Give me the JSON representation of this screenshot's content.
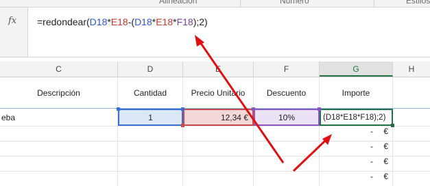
{
  "ribbon": {
    "groups": [
      "Alineación",
      "Número",
      "Estilos"
    ]
  },
  "formula_bar": {
    "fx_label": "fx",
    "parts": [
      "=redondear(",
      "D18",
      "*",
      "E18",
      "-(",
      "D18",
      "*",
      "E18",
      "*",
      "F18",
      ");2)"
    ]
  },
  "columns": [
    "C",
    "D",
    "E",
    "F",
    "G",
    "H"
  ],
  "active_column": "G",
  "header_row": {
    "c": "Descripción",
    "d": "Cantidad",
    "e": "Precio Unitario",
    "f": "Descuento",
    "g": "Importe"
  },
  "data_row": {
    "c": "eba",
    "d": "1",
    "e": "12,34 €",
    "f": "10%",
    "g": "(D18*E18*F18);2)"
  },
  "empty_rows": [
    {
      "dash": "-",
      "euro": "€"
    },
    {
      "dash": "-",
      "euro": "€"
    },
    {
      "dash": "-",
      "euro": "€"
    },
    {
      "dash": "-",
      "euro": "€"
    }
  ],
  "colors": {
    "accent_green": "#217346",
    "ref_blue": "#3a6fd6",
    "ref_red": "#c94a4a",
    "ref_purple": "#8e56c0",
    "arrow_red": "#e01010"
  }
}
